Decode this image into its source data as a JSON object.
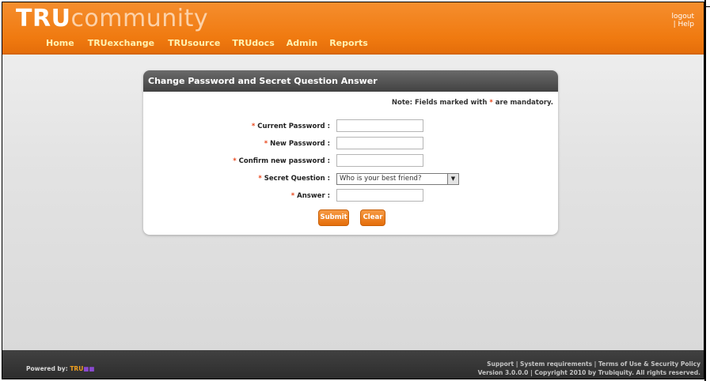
{
  "header": {
    "logo_primary": "TRU",
    "logo_secondary": "community",
    "nav": [
      "Home",
      "TRUexchange",
      "TRUsource",
      "TRUdocs",
      "Admin",
      "Reports"
    ],
    "logout": "logout",
    "help": "| Help"
  },
  "panel": {
    "title": "Change Password and Secret Question Answer",
    "note_prefix": "Note: Fields marked with",
    "note_star": "*",
    "note_suffix": "are mandatory.",
    "fields": [
      {
        "label": "Current Password :",
        "value": ""
      },
      {
        "label": "New Password :",
        "value": ""
      },
      {
        "label": "Confirm new password :",
        "value": ""
      },
      {
        "label": "Secret Question :",
        "value": "Who is your best friend?"
      },
      {
        "label": "Answer :",
        "value": ""
      }
    ],
    "star": "*",
    "submit": "Submit",
    "clear": "Clear"
  },
  "footer": {
    "powered_by": "Powered by:",
    "powered_brand": "TRU",
    "line1_support": "Support",
    "line1_sysreq": "System requirements",
    "line1_terms": "Terms of Use & Security Policy",
    "line2": "Version 3.0.0.0  | Copyright 2010 by Trubiquity. All rights reserved."
  },
  "colors": {
    "header_orange": "#f07a10",
    "button_orange": "#ee8226",
    "panel_header": "#4c4c4c",
    "footer_dark": "#363636"
  }
}
